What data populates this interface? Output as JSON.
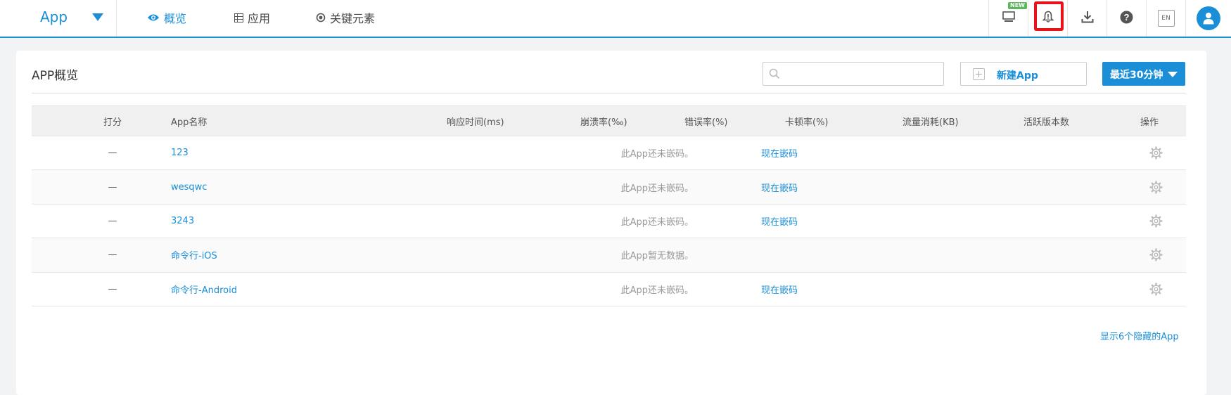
{
  "topbar": {
    "app_title": "App",
    "nav": [
      {
        "label": "概览",
        "icon": "eye-icon",
        "active": true
      },
      {
        "label": "应用",
        "icon": "list-icon",
        "active": false
      },
      {
        "label": "关键元素",
        "icon": "target-icon",
        "active": false
      }
    ],
    "new_badge": "NEW",
    "lang_badge": "EN",
    "tools": [
      "monitor-icon",
      "bell-icon",
      "download-icon",
      "help-icon",
      "language-icon",
      "user-icon"
    ]
  },
  "panel": {
    "title": "APP概览",
    "search": {
      "placeholder": "",
      "value": ""
    },
    "new_app_label": "新建App",
    "time_range_label": "最近30分钟",
    "columns": [
      "打分",
      "App名称",
      "响应时间(ms)",
      "崩溃率(‰)",
      "错误率(%)",
      "卡顿率(%)",
      "流量消耗(KB)",
      "活跃版本数",
      "操作"
    ],
    "rows": [
      {
        "score": "—",
        "name": "123",
        "message": "此App还未嵌码。",
        "action": "现在嵌码"
      },
      {
        "score": "—",
        "name": "wesqwc",
        "message": "此App还未嵌码。",
        "action": "现在嵌码"
      },
      {
        "score": "—",
        "name": "3243",
        "message": "此App还未嵌码。",
        "action": "现在嵌码"
      },
      {
        "score": "—",
        "name": "命令行-iOS",
        "message": "此App暂无数据。",
        "action": ""
      },
      {
        "score": "—",
        "name": "命令行-Android",
        "message": "此App还未嵌码。",
        "action": "现在嵌码"
      }
    ],
    "show_hidden_label": "显示6个隐藏的App"
  },
  "colors": {
    "accent": "#1a8fd7",
    "highlight": "#e8131a",
    "badge": "#5cb85c"
  }
}
